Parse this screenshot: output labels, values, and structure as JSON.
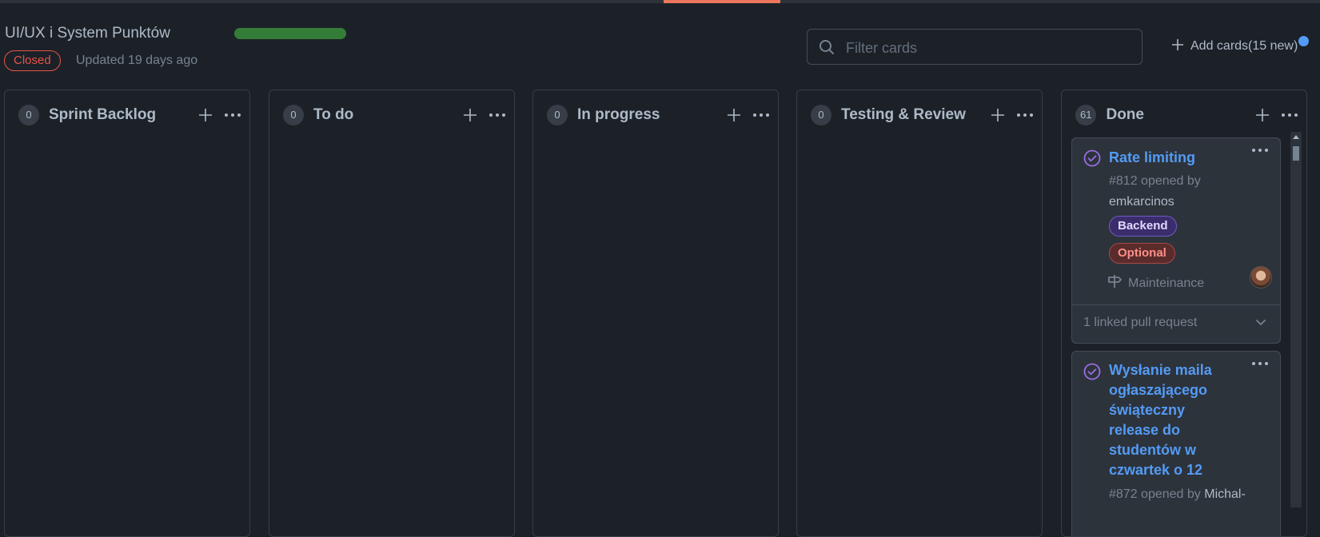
{
  "project": {
    "title": "UI/UX i System Punktów",
    "state": "Closed",
    "updated": "Updated 19 days ago",
    "progress_fraction": 1.0
  },
  "toolbar": {
    "filter_placeholder": "Filter cards",
    "add_cards_label": "Add cards(15 new)"
  },
  "colors": {
    "background": "#1c2128",
    "accent_blue": "#539bf5",
    "progress_green": "#347d39",
    "closed_red": "#e5534b",
    "done_purple": "#986ee2"
  },
  "columns": [
    {
      "name": "Sprint Backlog",
      "count": "0"
    },
    {
      "name": "To do",
      "count": "0"
    },
    {
      "name": "In progress",
      "count": "0"
    },
    {
      "name": "Testing & Review",
      "count": "0"
    },
    {
      "name": "Done",
      "count": "61"
    }
  ],
  "done_cards": [
    {
      "title": "Rate limiting",
      "number_opened": "#812 opened by",
      "author": "emkarcinos",
      "labels": [
        "Backend",
        "Optional"
      ],
      "milestone": "Mainteinance",
      "linked": "1 linked pull request"
    },
    {
      "title": "Wysłanie maila ogłaszającego świąteczny release do studentów w czwartek o 12",
      "number_opened": "#872 opened by",
      "author": "Michal-"
    }
  ],
  "icons": {
    "status": "issue-closed-icon",
    "search": "search-icon",
    "plus": "plus-icon",
    "more": "kebab-horizontal-icon",
    "milestone": "milestone-icon",
    "chevron": "chevron-down-icon"
  }
}
